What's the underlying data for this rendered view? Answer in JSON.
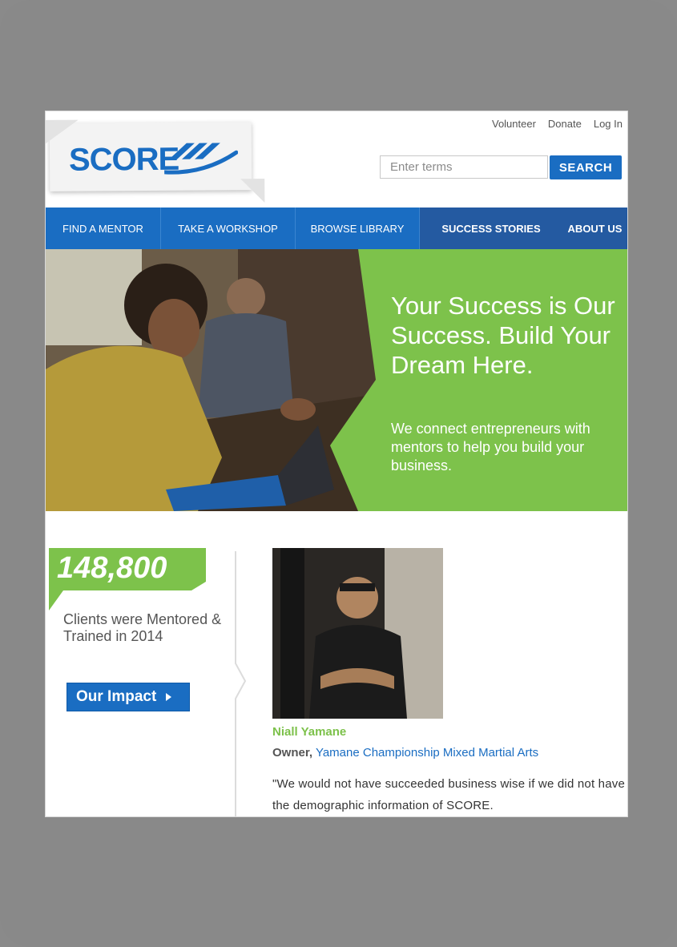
{
  "header": {
    "logo_text": "SCORE",
    "util_links": [
      "Volunteer",
      "Donate",
      "Log In"
    ],
    "search_placeholder": "Enter terms",
    "search_button": "SEARCH"
  },
  "nav": {
    "items": [
      {
        "label": "FIND A MENTOR"
      },
      {
        "label": "TAKE A WORKSHOP"
      },
      {
        "label": "BROWSE LIBRARY"
      },
      {
        "label": "SUCCESS STORIES"
      },
      {
        "label": "ABOUT US"
      }
    ]
  },
  "hero": {
    "title": "Your Success is Our Success. Build Your Dream Here.",
    "subtitle": "We connect entrepreneurs with mentors to help you build your business."
  },
  "stats": {
    "number": "148,800",
    "label": "Clients were Mentored & Trained in 2014",
    "button": "Our Impact"
  },
  "testimonial": {
    "name": "Niall Yamane",
    "role_prefix": "Owner,",
    "company": "Yamane Championship Mixed Martial Arts",
    "quote": "\"We would not have succeeded business wise if we did not have the demographic information of SCORE."
  },
  "colors": {
    "brand_blue": "#1a6dc2",
    "nav_dark": "#245aa1",
    "green": "#7dc24b"
  }
}
